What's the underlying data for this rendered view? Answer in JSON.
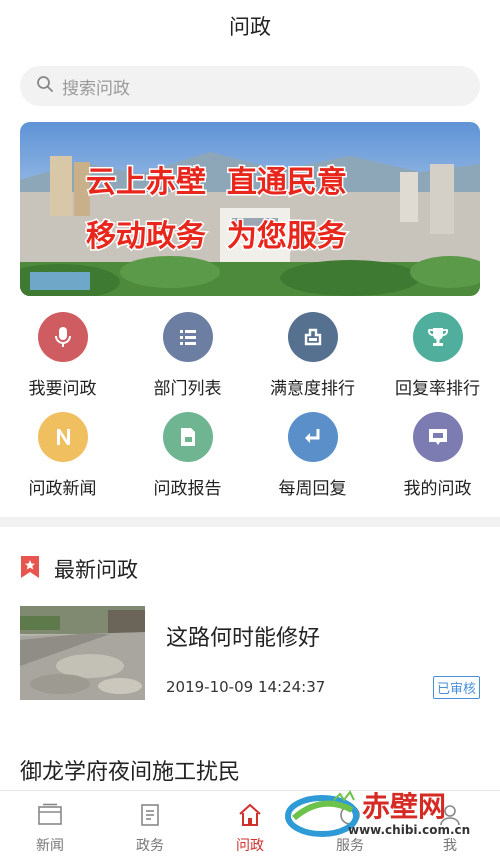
{
  "header": {
    "title": "问政"
  },
  "search": {
    "placeholder": "搜索问政",
    "icon": "search-icon"
  },
  "banner": {
    "line1": "云上赤壁  直通民意",
    "line2": "移动政务  为您服务"
  },
  "grid": {
    "items": [
      {
        "label": "我要问政",
        "color": "#cf5c60",
        "icon": "microphone-icon"
      },
      {
        "label": "部门列表",
        "color": "#6d7ea3",
        "icon": "list-icon"
      },
      {
        "label": "满意度排行",
        "color": "#56708f",
        "icon": "rank-icon"
      },
      {
        "label": "回复率排行",
        "color": "#4fae9c",
        "icon": "trophy-icon"
      },
      {
        "label": "问政新闻",
        "color": "#f0c060",
        "icon": "news-n-icon"
      },
      {
        "label": "问政报告",
        "color": "#6fb592",
        "icon": "report-icon"
      },
      {
        "label": "每周回复",
        "color": "#5a8fc9",
        "icon": "reply-icon"
      },
      {
        "label": "我的问政",
        "color": "#7c7bb2",
        "icon": "message-icon"
      }
    ]
  },
  "section": {
    "title": "最新问政",
    "icon": "bookmark-star-icon",
    "accent": "#e8554f"
  },
  "news": [
    {
      "headline": "这路何时能修好",
      "time": "2019-10-09 14:24:37",
      "badge": "已审核"
    },
    {
      "headline": "御龙学府夜间施工扰民"
    }
  ],
  "tabbar": {
    "items": [
      {
        "label": "新闻",
        "icon": "newspaper-icon",
        "active": false
      },
      {
        "label": "政务",
        "icon": "document-icon",
        "active": false
      },
      {
        "label": "问政",
        "icon": "home-icon",
        "active": true
      },
      {
        "label": "服务",
        "icon": "service-icon",
        "active": false
      },
      {
        "label": "我",
        "icon": "user-icon",
        "active": false
      }
    ]
  },
  "watermark": {
    "brand": "赤壁网",
    "url": "www.chibi.com.cn"
  }
}
